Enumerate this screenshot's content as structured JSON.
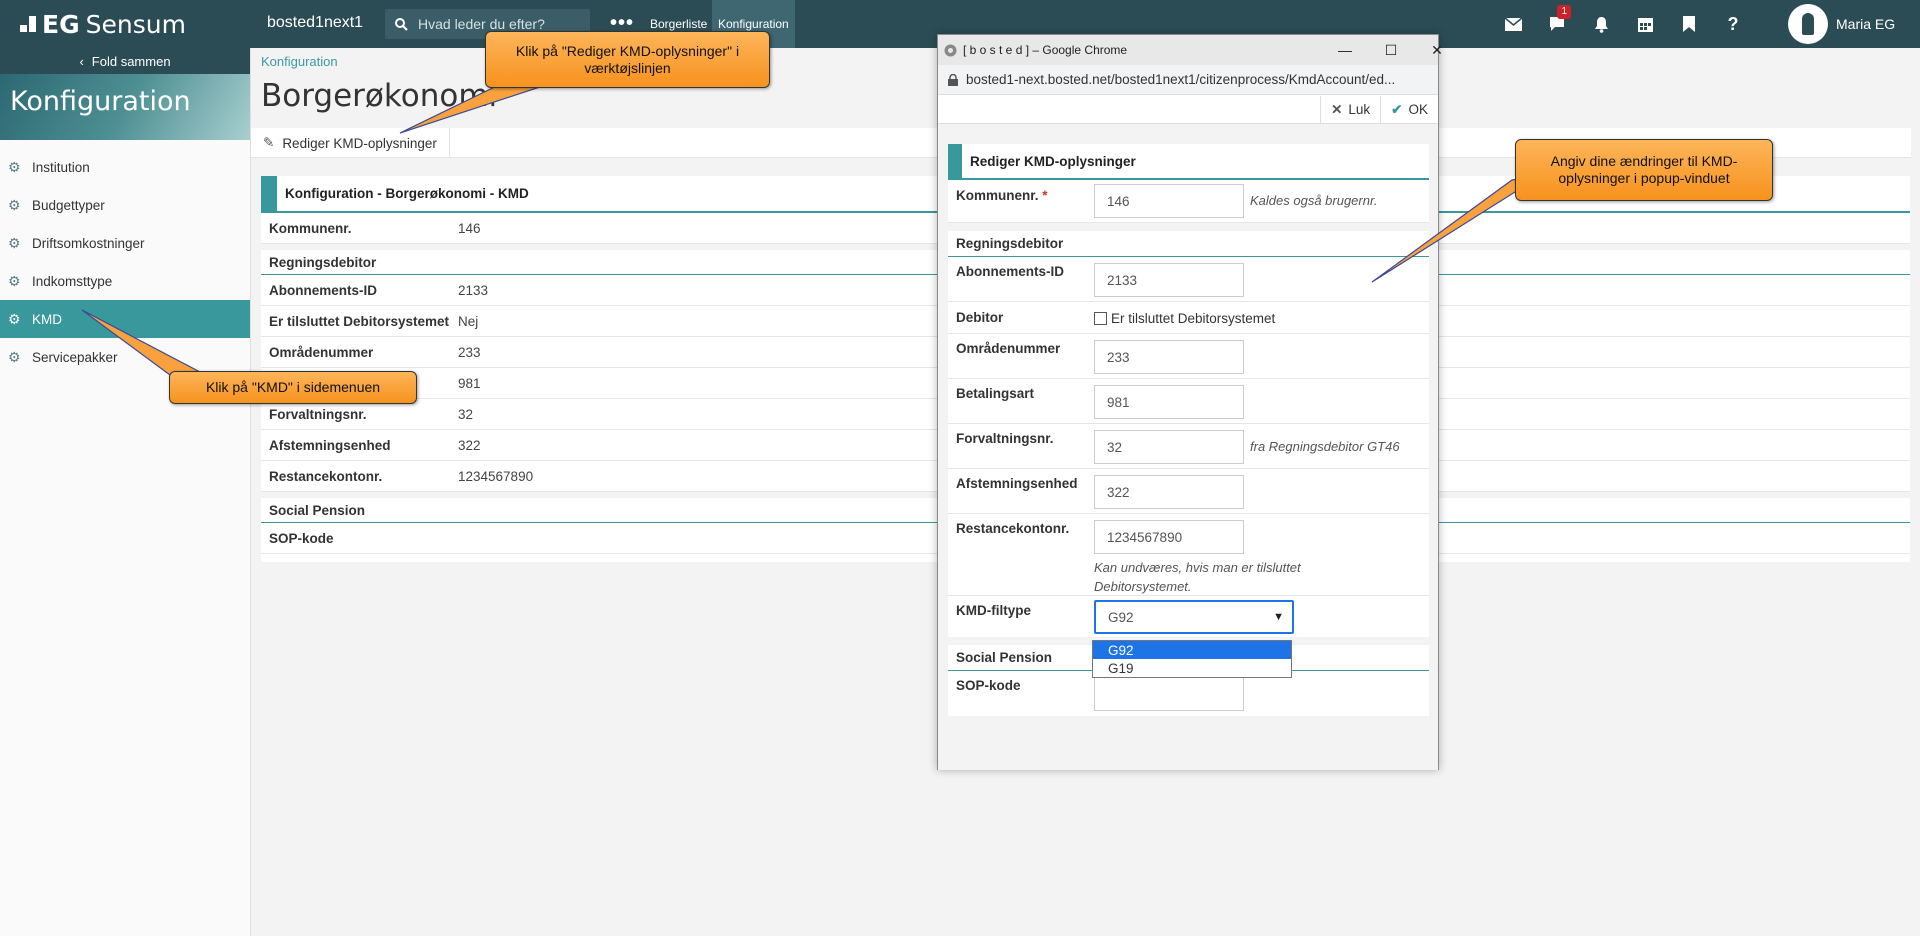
{
  "topbar": {
    "brand_eg": "EG",
    "brand_name": "Sensum",
    "environment": "bosted1next1",
    "search_placeholder": "Hvad leder du efter?",
    "more_label": "•••",
    "tabs": [
      {
        "label": "Borgerliste"
      },
      {
        "label": "Konfiguration"
      }
    ],
    "messages_badge": "1",
    "help_label": "?",
    "user_name": "Maria EG"
  },
  "sidebar": {
    "fold_label": "Fold sammen",
    "title": "Konfiguration",
    "items": [
      {
        "label": "Institution"
      },
      {
        "label": "Budgettyper"
      },
      {
        "label": "Driftsomkostninger"
      },
      {
        "label": "Indkomsttype"
      },
      {
        "label": "KMD"
      },
      {
        "label": "Servicepakker"
      }
    ]
  },
  "main": {
    "breadcrumb": "Konfiguration",
    "title": "Borgerøkonomi",
    "toolbar_edit": "Rediger KMD-oplysninger",
    "panel_title": "Konfiguration - Borgerøkonomi - KMD",
    "rows": [
      {
        "k": "Kommunenr.",
        "v": "146"
      },
      {
        "k": "Regningsdebitor",
        "v": ""
      },
      {
        "k": "Abonnements-ID",
        "v": "2133"
      },
      {
        "k": "Er tilsluttet Debitorsystemet",
        "v": "Nej"
      },
      {
        "k": "Områdenummer",
        "v": "233"
      },
      {
        "k": "",
        "v": "981"
      },
      {
        "k": "Forvaltningsnr.",
        "v": "32"
      },
      {
        "k": "Afstemningsenhed",
        "v": "322"
      },
      {
        "k": "Restancekontonr.",
        "v": "1234567890"
      },
      {
        "k": "Social Pension",
        "v": ""
      },
      {
        "k": "SOP-kode",
        "v": ""
      }
    ]
  },
  "popup": {
    "window_title": "[ b o s t e d ] – Google Chrome",
    "url": "bosted1-next.bosted.net/bosted1next1/citizenprocess/KmdAccount/ed...",
    "close_label": "Luk",
    "ok_label": "OK",
    "form_title": "Rediger KMD-oplysninger",
    "kommunenr_label": "Kommunenr.",
    "required_mark": "*",
    "kommunenr_value": "146",
    "kommunenr_hint": "Kaldes også brugernr.",
    "section_regningsdebitor": "Regningsdebitor",
    "abonnement_label": "Abonnements-ID",
    "abonnement_value": "2133",
    "debitor_label": "Debitor",
    "debitor_checkbox_label": "Er tilsluttet Debitorsystemet",
    "omraade_label": "Områdenummer",
    "omraade_value": "233",
    "betalingsart_label": "Betalingsart",
    "betalingsart_value": "981",
    "forvaltning_label": "Forvaltningsnr.",
    "forvaltning_value": "32",
    "forvaltning_hint": "fra Regningsdebitor GT46",
    "afstemning_label": "Afstemningsenhed",
    "afstemning_value": "322",
    "restance_label": "Restancekontonr.",
    "restance_value": "1234567890",
    "restance_hint": "Kan undværes, hvis man er tilsluttet Debitorsystemet.",
    "filtype_label": "KMD-filtype",
    "filtype_value": "G92",
    "filtype_options": [
      "G92",
      "G19"
    ],
    "section_social": "Social Pension",
    "sop_label": "SOP-kode",
    "sop_value": ""
  },
  "callouts": {
    "toolbar_tip": "Klik på \"Rediger KMD-oplysninger\" i værktøjslinjen",
    "kmd_tip": "Klik på \"KMD\" i sidemenuen",
    "popup_tip": "Angiv dine ændringer til KMD-oplysninger i popup-vinduet"
  },
  "colors": {
    "topbar": "#2c4c55",
    "accent": "#38989b",
    "callout": "#f7921e"
  }
}
